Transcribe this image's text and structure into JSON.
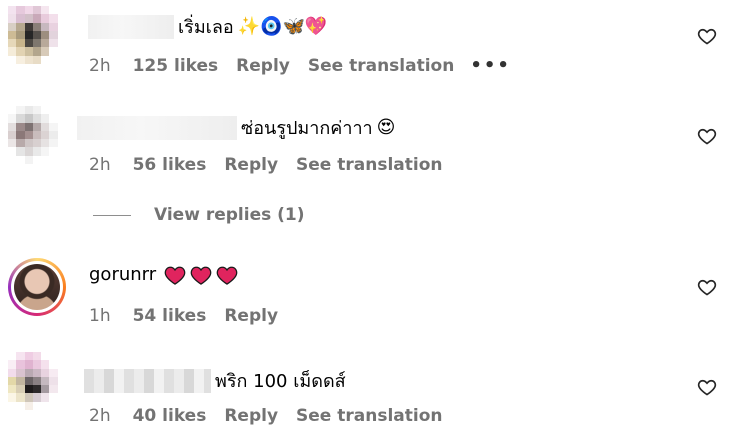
{
  "comments": [
    {
      "text": "เริ่มเลอ",
      "emojis": "✨🧿🦋💖",
      "time": "2h",
      "likes": "125 likes",
      "reply": "Reply",
      "translate": "See translation",
      "more": "•••"
    },
    {
      "text": "ซ่อนรูปมากค่าาา",
      "emojis": "😍",
      "time": "2h",
      "likes": "56 likes",
      "reply": "Reply",
      "translate": "See translation"
    },
    {
      "username": "gorunrr",
      "time": "1h",
      "likes": "54 likes",
      "reply": "Reply"
    },
    {
      "text": "พริก 100 เม็ดดส์",
      "time": "2h",
      "likes": "40 likes",
      "reply": "Reply",
      "translate": "See translation"
    }
  ],
  "view_replies": "View replies (1)",
  "colors": {
    "meta": "#737373",
    "heart_red": "#e0245e",
    "story_ring": "#d62976"
  }
}
